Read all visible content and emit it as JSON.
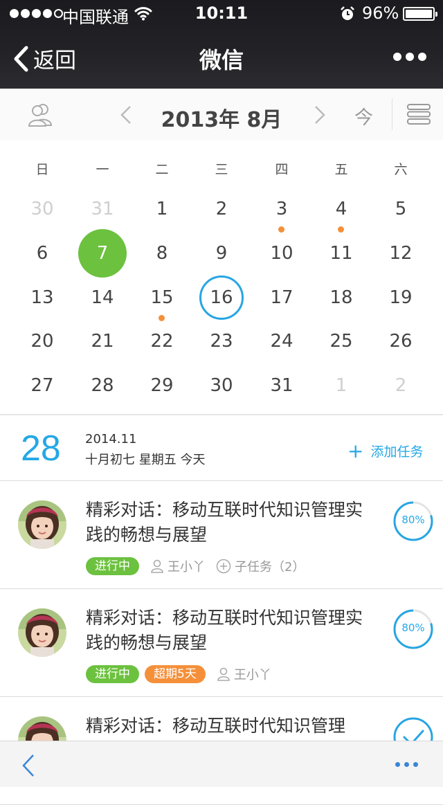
{
  "status_bar": {
    "carrier": "中国联通",
    "time": "10:11",
    "battery": "96%"
  },
  "nav": {
    "back_label": "返回",
    "title": "微信"
  },
  "month_bar": {
    "month_label": "2013年 8月",
    "today_label": "今"
  },
  "calendar": {
    "weekdays": [
      "日",
      "一",
      "二",
      "三",
      "四",
      "五",
      "六"
    ],
    "weeks": [
      [
        "30",
        "31",
        "1",
        "2",
        "3",
        "4",
        "5"
      ],
      [
        "6",
        "7",
        "8",
        "9",
        "10",
        "11",
        "12"
      ],
      [
        "13",
        "14",
        "15",
        "16",
        "17",
        "18",
        "19"
      ],
      [
        "20",
        "21",
        "22",
        "23",
        "24",
        "25",
        "26"
      ],
      [
        "27",
        "28",
        "29",
        "30",
        "31",
        "1",
        "2"
      ]
    ],
    "muted_days": [
      "0-0",
      "0-1",
      "4-5",
      "4-6"
    ],
    "event_days": [
      "0-4",
      "0-5",
      "2-2"
    ],
    "selected_day": "7",
    "today_day": "16",
    "colors": {
      "selected": "#6cc13f",
      "today_ring": "#27a5e3",
      "event_dot": "#f5903a"
    }
  },
  "date_info": {
    "day": "28",
    "year_month": "2014.11",
    "lunar_weekday": "十月初七 星期五 今天",
    "add_task_label": "添加任务"
  },
  "tasks": [
    {
      "title": "精彩对话：移动互联时代知识管理实践的畅想与展望",
      "status": "进行中",
      "assignee": "王小丫",
      "subtasks": "子任务（2）",
      "progress_label": "80%",
      "progress": 0.8
    },
    {
      "title": "精彩对话：移动互联时代知识管理实践的畅想与展望",
      "status": "进行中",
      "overdue": "超期5天",
      "assignee": "王小丫",
      "progress_label": "80%",
      "progress": 0.8
    },
    {
      "title": "精彩对话：移动互联时代知识管理",
      "done": true
    }
  ]
}
